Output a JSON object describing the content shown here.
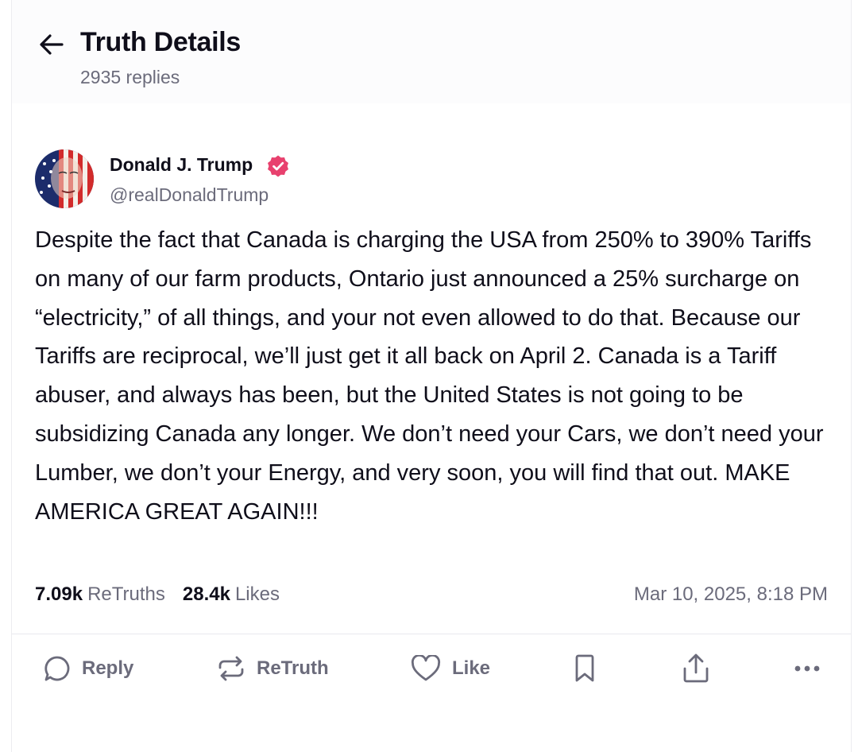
{
  "header": {
    "title": "Truth Details",
    "subtitle": "2935 replies"
  },
  "post": {
    "author": {
      "name": "Donald J. Trump",
      "handle": "@realDonaldTrump",
      "verified": true,
      "verified_color": "#e8416e"
    },
    "text": "Despite the fact that Canada is charging the USA from 250% to 390% Tariffs on many of our farm products, Ontario just announced a 25% surcharge on “electricity,” of all things, and your not even allowed to do that. Because our Tariffs are reciprocal, we’ll just get it all back on April 2. Canada is a Tariff abuser, and always has been, but the United States is not going to be subsidizing Canada any longer. We don’t need your Cars, we don’t need your Lumber, we don’t your Energy, and very soon, you will find that out. MAKE AMERICA GREAT AGAIN!!!",
    "stats": {
      "retruths_count": "7.09k",
      "retruths_label": "ReTruths",
      "likes_count": "28.4k",
      "likes_label": "Likes"
    },
    "timestamp": "Mar 10, 2025, 8:18 PM"
  },
  "actions": {
    "reply": "Reply",
    "retruth": "ReTruth",
    "like": "Like",
    "icons": [
      "reply-icon",
      "retruth-icon",
      "like-icon",
      "bookmark-icon",
      "share-icon",
      "more-icon"
    ]
  },
  "colors": {
    "text_primary": "#0f0e1a",
    "text_secondary": "#6b6b7b",
    "icon": "#6b6b7b"
  }
}
